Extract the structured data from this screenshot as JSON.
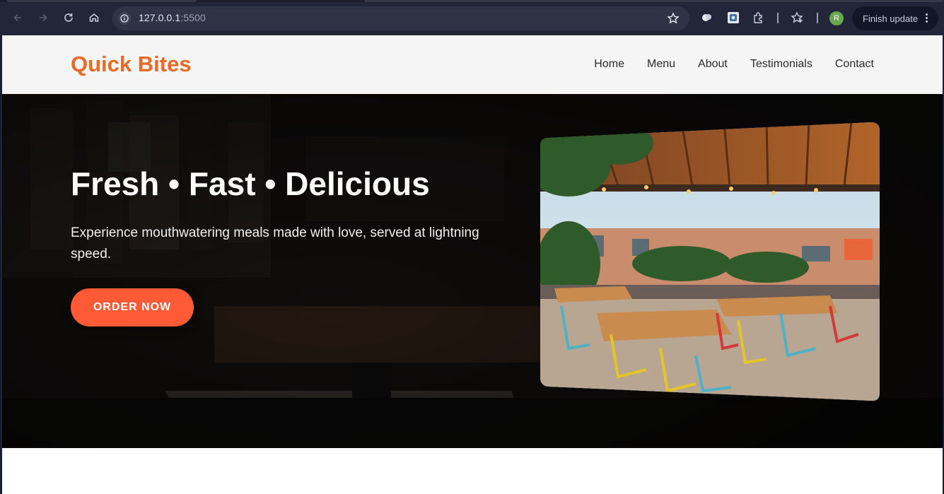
{
  "browser": {
    "url_host": "127.0.0.1",
    "url_port": ":5500",
    "avatar_initial": "R",
    "update_label": "Finish update"
  },
  "site": {
    "logo": "Quick Bites",
    "nav": [
      "Home",
      "Menu",
      "About",
      "Testimonials",
      "Contact"
    ]
  },
  "hero": {
    "title": "Fresh • Fast • Delicious",
    "subtitle": "Experience mouthwatering meals made with love, served at lightning speed.",
    "cta": "ORDER NOW"
  },
  "colors": {
    "brand": "#ea6a23",
    "cta": "#ff5a36"
  },
  "icons": [
    "back-icon",
    "forward-icon",
    "reload-icon",
    "home-icon",
    "site-info-icon",
    "bookmark-star-icon",
    "extension-icons",
    "menu-dots-icon"
  ]
}
